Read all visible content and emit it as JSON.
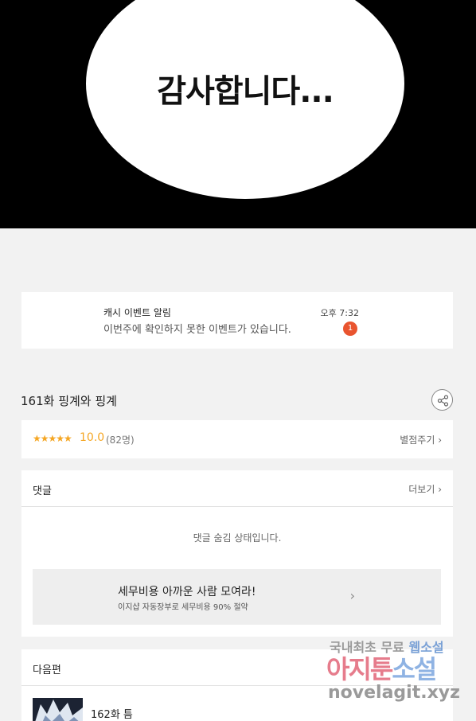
{
  "comic": {
    "bubble_text": "감사합니다..."
  },
  "notice": {
    "title": "캐시 이벤트 알림",
    "message": "이번주에 확인하지 못한 이벤트가 있습니다.",
    "time": "오후 7:32",
    "badge_count": "1"
  },
  "episode": {
    "title": "161화 핑계와 핑계"
  },
  "rating": {
    "stars": "★★★★★",
    "score": "10.0",
    "count": "(82명)",
    "rate_link": "별점주기 ›"
  },
  "comments": {
    "title": "댓글",
    "more": "더보기 ›",
    "hidden_message": "댓글 숨김 상태입니다.",
    "promo_title": "세무비용 아까운 사람 모여라!",
    "promo_subtitle": "이지샵 자동장부로 세무비용 90% 절약",
    "promo_chevron": "›"
  },
  "next": {
    "title": "다음편",
    "episode": "162화 틈"
  },
  "watermark": {
    "line1_a": "국내최초 무료 ",
    "line1_b": "웹소설",
    "line2_a": "아지툰",
    "line2_b": "소설",
    "line3": "novelagit.xyz"
  },
  "icons": {
    "share": "share-icon"
  }
}
